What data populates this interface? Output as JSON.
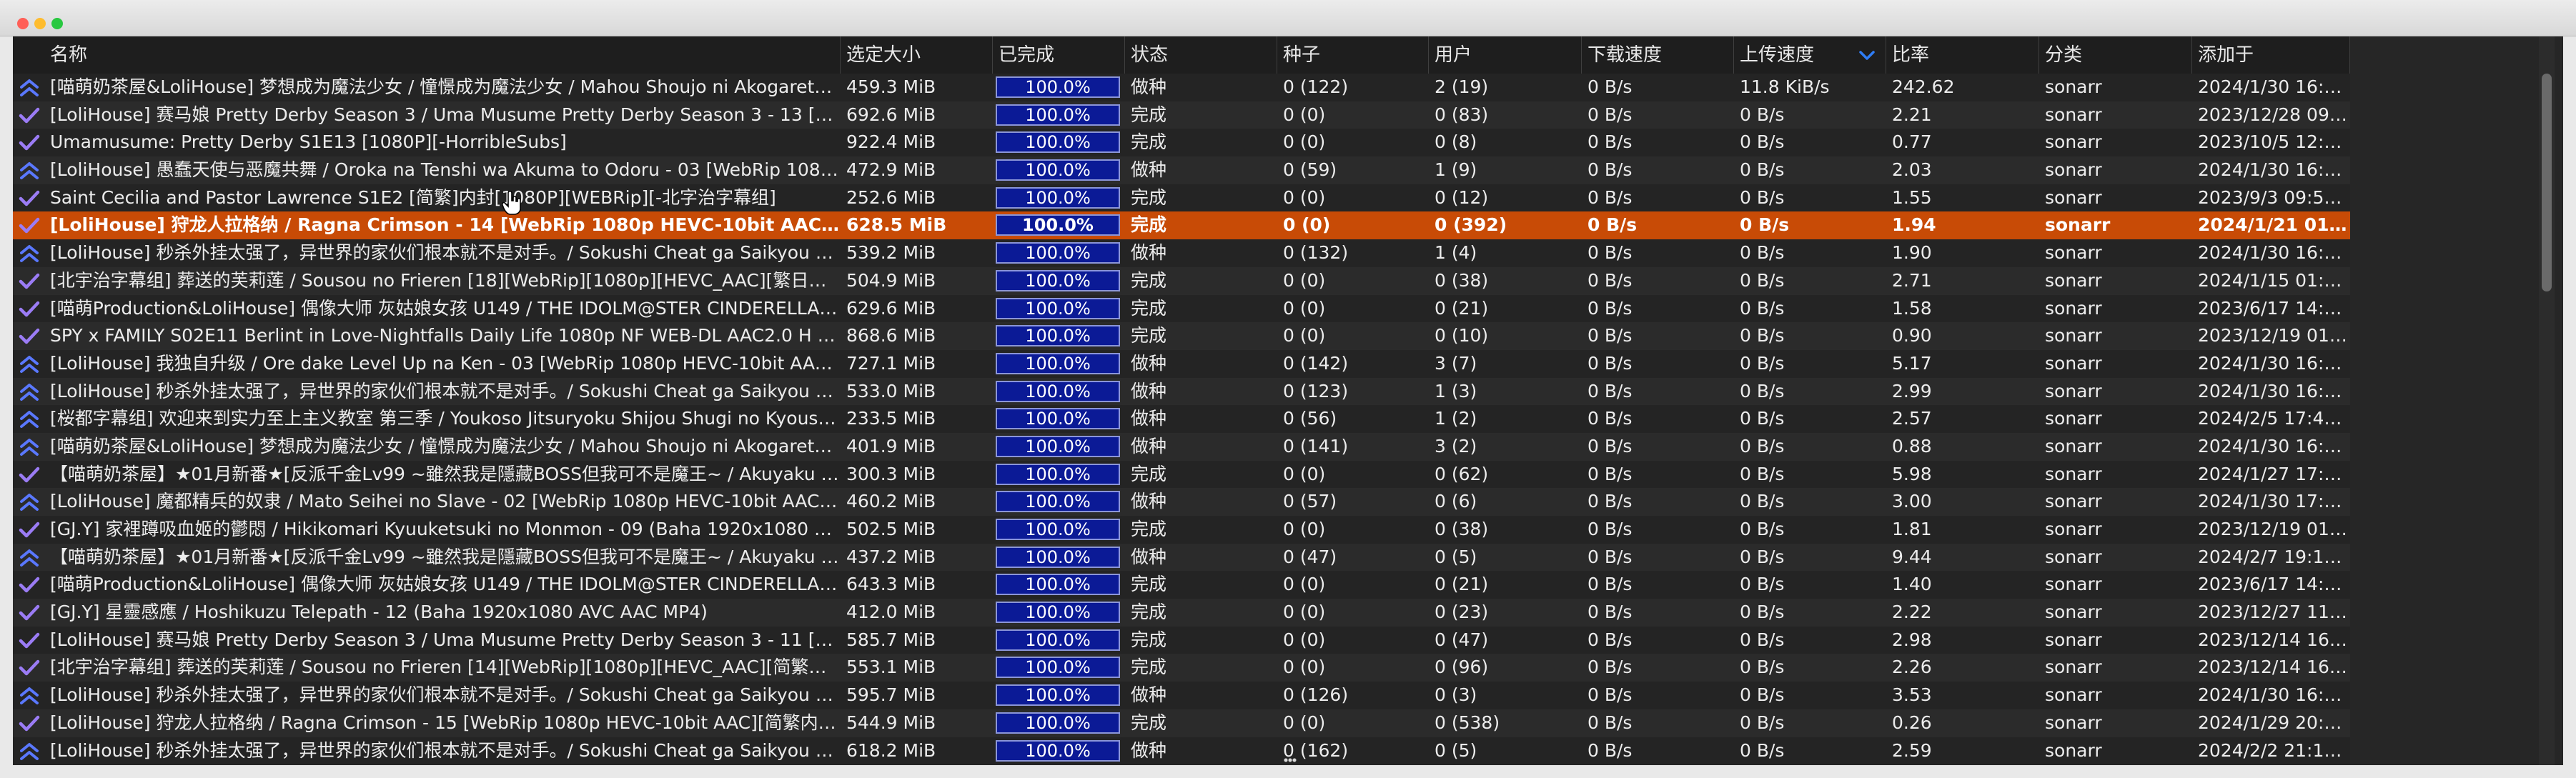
{
  "window": {
    "title": "",
    "controls": [
      "close",
      "minimize",
      "maximize"
    ]
  },
  "colors": {
    "selected_row": "#c84b06",
    "progress_fill": "#0b1a96",
    "seeding_icon": "#5a78ff",
    "done_icon": "#9b7cf5"
  },
  "columns": [
    "名称",
    "选定大小",
    "已完成",
    "状态",
    "种子",
    "用户",
    "下载速度",
    "上传速度",
    "比率",
    "分类",
    "添加于"
  ],
  "sort": {
    "column": "上传速度",
    "direction": "descending",
    "icon": "chevron-down-icon"
  },
  "selected_row_index": 5,
  "rows": [
    {
      "icon": "double-chevron-up-icon",
      "name": "[喵萌奶茶屋&LoliHouse] 梦想成为魔法少女 / 憧憬成为魔法少女 / Mahou Shoujo ni Akogarete -…",
      "size": "459.3 MiB",
      "done": "100.0%",
      "progress": 1.0,
      "status": "做种",
      "seeds": "0 (122)",
      "peers": "2 (19)",
      "down": "0 B/s",
      "up": "11.8 KiB/s",
      "ratio": "242.62",
      "category": "sonarr",
      "added": "2024/1/30 16:5…"
    },
    {
      "icon": "check-icon",
      "name": "[LoliHouse] 赛马娘 Pretty Derby Season 3 / Uma Musume Pretty Derby Season 3 - 13 [WebRi…",
      "size": "692.6 MiB",
      "done": "100.0%",
      "progress": 1.0,
      "status": "完成",
      "seeds": "0 (0)",
      "peers": "0 (83)",
      "down": "0 B/s",
      "up": "0 B/s",
      "ratio": "2.21",
      "category": "sonarr",
      "added": "2023/12/28 09:…"
    },
    {
      "icon": "check-icon",
      "name": "Umamusume: Pretty Derby S1E13 [1080P][-HorribleSubs]",
      "size": "922.4 MiB",
      "done": "100.0%",
      "progress": 1.0,
      "status": "完成",
      "seeds": "0 (0)",
      "peers": "0 (8)",
      "down": "0 B/s",
      "up": "0 B/s",
      "ratio": "0.77",
      "category": "sonarr",
      "added": "2023/10/5 12:0…"
    },
    {
      "icon": "double-chevron-up-icon",
      "name": "[LoliHouse] 愚蠢天使与恶魔共舞 / Oroka na Tenshi wa Akuma to Odoru - 03 [WebRip 1080p H…",
      "size": "472.9 MiB",
      "done": "100.0%",
      "progress": 1.0,
      "status": "做种",
      "seeds": "0 (59)",
      "peers": "1 (9)",
      "down": "0 B/s",
      "up": "0 B/s",
      "ratio": "2.03",
      "category": "sonarr",
      "added": "2024/1/30 16:5…"
    },
    {
      "icon": "check-icon",
      "name": "Saint Cecilia and Pastor Lawrence S1E2 [简繁]内封[1080P][WEBRip][-北字治字幕组]",
      "size": "252.6 MiB",
      "done": "100.0%",
      "progress": 1.0,
      "status": "完成",
      "seeds": "0 (0)",
      "peers": "0 (12)",
      "down": "0 B/s",
      "up": "0 B/s",
      "ratio": "1.55",
      "category": "sonarr",
      "added": "2023/9/3 09:56:…"
    },
    {
      "icon": "check-icon",
      "name": "[LoliHouse] 狩龙人拉格纳 / Ragna Crimson - 14 [WebRip 1080p HEVC-10bit AAC][简繁内封字…",
      "size": "628.5 MiB",
      "done": "100.0%",
      "progress": 1.0,
      "status": "完成",
      "seeds": "0 (0)",
      "peers": "0 (392)",
      "down": "0 B/s",
      "up": "0 B/s",
      "ratio": "1.94",
      "category": "sonarr",
      "added": "2024/1/21 01:2…"
    },
    {
      "icon": "double-chevron-up-icon",
      "name": "[LoliHouse] 秒杀外挂太强了，异世界的家伙们根本就不是对手。/ Sokushi Cheat ga Saikyou …",
      "size": "539.2 MiB",
      "done": "100.0%",
      "progress": 1.0,
      "status": "做种",
      "seeds": "0 (132)",
      "peers": "1 (4)",
      "down": "0 B/s",
      "up": "0 B/s",
      "ratio": "1.90",
      "category": "sonarr",
      "added": "2024/1/30 16:5…"
    },
    {
      "icon": "check-icon",
      "name": "[北宇治字幕组] 葬送的芙莉莲 / Sousou no Frieren [18][WebRip][1080p][HEVC_AAC][繁日内嵌…",
      "size": "504.9 MiB",
      "done": "100.0%",
      "progress": 1.0,
      "status": "完成",
      "seeds": "0 (0)",
      "peers": "0 (38)",
      "down": "0 B/s",
      "up": "0 B/s",
      "ratio": "2.71",
      "category": "sonarr",
      "added": "2024/1/15 01:1…"
    },
    {
      "icon": "check-icon",
      "name": "[喵萌Production&LoliHouse] 偶像大师 灰姑娘女孩 U149 / THE IDOLM@STER CINDERELLA …",
      "size": "629.6 MiB",
      "done": "100.0%",
      "progress": 1.0,
      "status": "完成",
      "seeds": "0 (0)",
      "peers": "0 (21)",
      "down": "0 B/s",
      "up": "0 B/s",
      "ratio": "1.58",
      "category": "sonarr",
      "added": "2023/6/17 14:1…"
    },
    {
      "icon": "check-icon",
      "name": "SPY x FAMILY S02E11 Berlint in Love-Nightfalls Daily Life 1080p NF WEB-DL AAC2.0 H 264-…",
      "size": "868.6 MiB",
      "done": "100.0%",
      "progress": 1.0,
      "status": "完成",
      "seeds": "0 (0)",
      "peers": "0 (10)",
      "down": "0 B/s",
      "up": "0 B/s",
      "ratio": "0.90",
      "category": "sonarr",
      "added": "2023/12/19 01:…"
    },
    {
      "icon": "double-chevron-up-icon",
      "name": "[LoliHouse] 我独自升级 / Ore dake Level Up na Ken - 03 [WebRip 1080p HEVC-10bit AAC][简…",
      "size": "727.1 MiB",
      "done": "100.0%",
      "progress": 1.0,
      "status": "做种",
      "seeds": "0 (142)",
      "peers": "3 (7)",
      "down": "0 B/s",
      "up": "0 B/s",
      "ratio": "5.17",
      "category": "sonarr",
      "added": "2024/1/30 16:5…"
    },
    {
      "icon": "double-chevron-up-icon",
      "name": "[LoliHouse] 秒杀外挂太强了，异世界的家伙们根本就不是对手。/ Sokushi Cheat ga Saikyou …",
      "size": "533.0 MiB",
      "done": "100.0%",
      "progress": 1.0,
      "status": "做种",
      "seeds": "0 (123)",
      "peers": "1 (3)",
      "down": "0 B/s",
      "up": "0 B/s",
      "ratio": "2.99",
      "category": "sonarr",
      "added": "2024/1/30 16:5…"
    },
    {
      "icon": "double-chevron-up-icon",
      "name": "[桜都字幕组] 欢迎来到实力至上主义教室 第三季 / Youkoso Jitsuryoku Shijou Shugi no Kyoushi…",
      "size": "233.5 MiB",
      "done": "100.0%",
      "progress": 1.0,
      "status": "做种",
      "seeds": "0 (56)",
      "peers": "1 (2)",
      "down": "0 B/s",
      "up": "0 B/s",
      "ratio": "2.57",
      "category": "sonarr",
      "added": "2024/2/5 17:45:…"
    },
    {
      "icon": "double-chevron-up-icon",
      "name": "[喵萌奶茶屋&LoliHouse] 梦想成为魔法少女 / 憧憬成为魔法少女 / Mahou Shoujo ni Akogarete -…",
      "size": "401.9 MiB",
      "done": "100.0%",
      "progress": 1.0,
      "status": "做种",
      "seeds": "0 (141)",
      "peers": "3 (2)",
      "down": "0 B/s",
      "up": "0 B/s",
      "ratio": "0.88",
      "category": "sonarr",
      "added": "2024/1/30 16:5…"
    },
    {
      "icon": "check-icon",
      "name": "【喵萌奶茶屋】★01月新番★[反派千金Lv99 ~雖然我是隱藏BOSS但我可不是魔王~ / Akuyaku …",
      "size": "300.3 MiB",
      "done": "100.0%",
      "progress": 1.0,
      "status": "完成",
      "seeds": "0 (0)",
      "peers": "0 (62)",
      "down": "0 B/s",
      "up": "0 B/s",
      "ratio": "5.98",
      "category": "sonarr",
      "added": "2024/1/27 17:5…"
    },
    {
      "icon": "double-chevron-up-icon",
      "name": "[LoliHouse] 魔都精兵的奴隶 / Mato Seihei no Slave - 02 [WebRip 1080p HEVC-10bit AAC][繁…",
      "size": "460.2 MiB",
      "done": "100.0%",
      "progress": 1.0,
      "status": "做种",
      "seeds": "0 (57)",
      "peers": "0 (6)",
      "down": "0 B/s",
      "up": "0 B/s",
      "ratio": "3.00",
      "category": "sonarr",
      "added": "2024/1/30 17:0…"
    },
    {
      "icon": "check-icon",
      "name": "[GJ.Y] 家裡蹲吸血姬的鬱悶 / Hikikomari Kyuuketsuki no Monmon - 09 (Baha 1920x1080 AVC …",
      "size": "502.5 MiB",
      "done": "100.0%",
      "progress": 1.0,
      "status": "完成",
      "seeds": "0 (0)",
      "peers": "0 (38)",
      "down": "0 B/s",
      "up": "0 B/s",
      "ratio": "1.81",
      "category": "sonarr",
      "added": "2023/12/19 01:…"
    },
    {
      "icon": "double-chevron-up-icon",
      "name": "【喵萌奶茶屋】★01月新番★[反派千金Lv99 ~雖然我是隱藏BOSS但我可不是魔王~ / Akuyaku …",
      "size": "437.2 MiB",
      "done": "100.0%",
      "progress": 1.0,
      "status": "做种",
      "seeds": "0 (47)",
      "peers": "0 (5)",
      "down": "0 B/s",
      "up": "0 B/s",
      "ratio": "9.44",
      "category": "sonarr",
      "added": "2024/2/7 19:10:…"
    },
    {
      "icon": "check-icon",
      "name": "[喵萌Production&LoliHouse] 偶像大师 灰姑娘女孩 U149 / THE IDOLM@STER CINDERELLA …",
      "size": "643.3 MiB",
      "done": "100.0%",
      "progress": 1.0,
      "status": "完成",
      "seeds": "0 (0)",
      "peers": "0 (21)",
      "down": "0 B/s",
      "up": "0 B/s",
      "ratio": "1.40",
      "category": "sonarr",
      "added": "2023/6/17 14:1…"
    },
    {
      "icon": "check-icon",
      "name": "[GJ.Y] 星靈感應 / Hoshikuzu Telepath - 12 (Baha 1920x1080 AVC AAC MP4)",
      "size": "412.0 MiB",
      "done": "100.0%",
      "progress": 1.0,
      "status": "完成",
      "seeds": "0 (0)",
      "peers": "0 (23)",
      "down": "0 B/s",
      "up": "0 B/s",
      "ratio": "2.22",
      "category": "sonarr",
      "added": "2023/12/27 11:…"
    },
    {
      "icon": "check-icon",
      "name": "[LoliHouse] 赛马娘 Pretty Derby Season 3 / Uma Musume Pretty Derby Season 3 - 11 [WebRi…",
      "size": "585.7 MiB",
      "done": "100.0%",
      "progress": 1.0,
      "status": "完成",
      "seeds": "0 (0)",
      "peers": "0 (47)",
      "down": "0 B/s",
      "up": "0 B/s",
      "ratio": "2.98",
      "category": "sonarr",
      "added": "2023/12/14 16:…"
    },
    {
      "icon": "check-icon",
      "name": "[北宇治字幕组] 葬送的芙莉莲 / Sousou no Frieren [14][WebRip][1080p][HEVC_AAC][简繁日内…",
      "size": "553.1 MiB",
      "done": "100.0%",
      "progress": 1.0,
      "status": "完成",
      "seeds": "0 (0)",
      "peers": "0 (96)",
      "down": "0 B/s",
      "up": "0 B/s",
      "ratio": "2.26",
      "category": "sonarr",
      "added": "2023/12/14 16:…"
    },
    {
      "icon": "double-chevron-up-icon",
      "name": "[LoliHouse] 秒杀外挂太强了，异世界的家伙们根本就不是对手。/ Sokushi Cheat ga Saikyou …",
      "size": "595.7 MiB",
      "done": "100.0%",
      "progress": 1.0,
      "status": "做种",
      "seeds": "0 (126)",
      "peers": "0 (3)",
      "down": "0 B/s",
      "up": "0 B/s",
      "ratio": "3.53",
      "category": "sonarr",
      "added": "2024/1/30 16:5…"
    },
    {
      "icon": "check-icon",
      "name": "[LoliHouse] 狩龙人拉格纳 / Ragna Crimson - 15 [WebRip 1080p HEVC-10bit AAC][简繁内封字…",
      "size": "544.9 MiB",
      "done": "100.0%",
      "progress": 1.0,
      "status": "完成",
      "seeds": "0 (0)",
      "peers": "0 (538)",
      "down": "0 B/s",
      "up": "0 B/s",
      "ratio": "0.26",
      "category": "sonarr",
      "added": "2024/1/29 20:2…"
    },
    {
      "icon": "double-chevron-up-icon",
      "name": "[LoliHouse] 秒杀外挂太强了，异世界的家伙们根本就不是对手。/ Sokushi Cheat ga Saikyou …",
      "size": "618.2 MiB",
      "done": "100.0%",
      "progress": 1.0,
      "status": "做种",
      "seeds": "0 (162)",
      "peers": "0 (5)",
      "down": "0 B/s",
      "up": "0 B/s",
      "ratio": "2.59",
      "category": "sonarr",
      "added": "2024/2/2 21:10:…"
    }
  ]
}
